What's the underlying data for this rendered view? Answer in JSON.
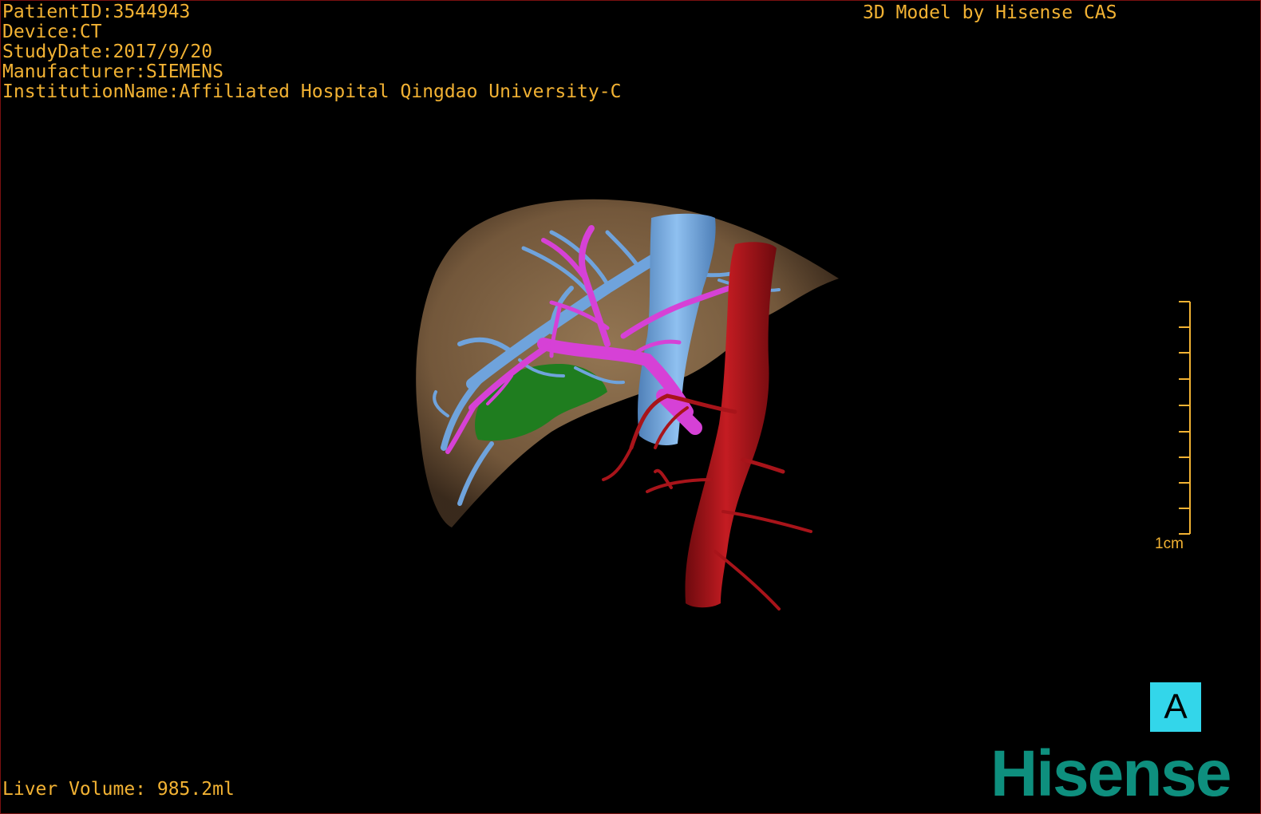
{
  "viewer": {
    "info": [
      "PatientID:3544943",
      "Device:CT",
      "StudyDate:2017/9/20",
      "Manufacturer:SIEMENS",
      "InstitutionName:Affiliated Hospital Qingdao University-C"
    ],
    "credit": "3D Model by Hisense CAS",
    "volume": "Liver Volume: 985.2ml",
    "scale_label": "1cm",
    "view_label": "A",
    "brand": "Hisense"
  },
  "colors": {
    "overlay_text": "#f2b233",
    "liver": "#8a6a48",
    "hepatic_vein": "#6fa3dc",
    "portal_vein": "#d641d6",
    "artery": "#a8141a",
    "gallbladder": "#1f7d1f",
    "badge": "#33d6ea",
    "brand": "#0e8f7e",
    "border": "#7a1010"
  }
}
